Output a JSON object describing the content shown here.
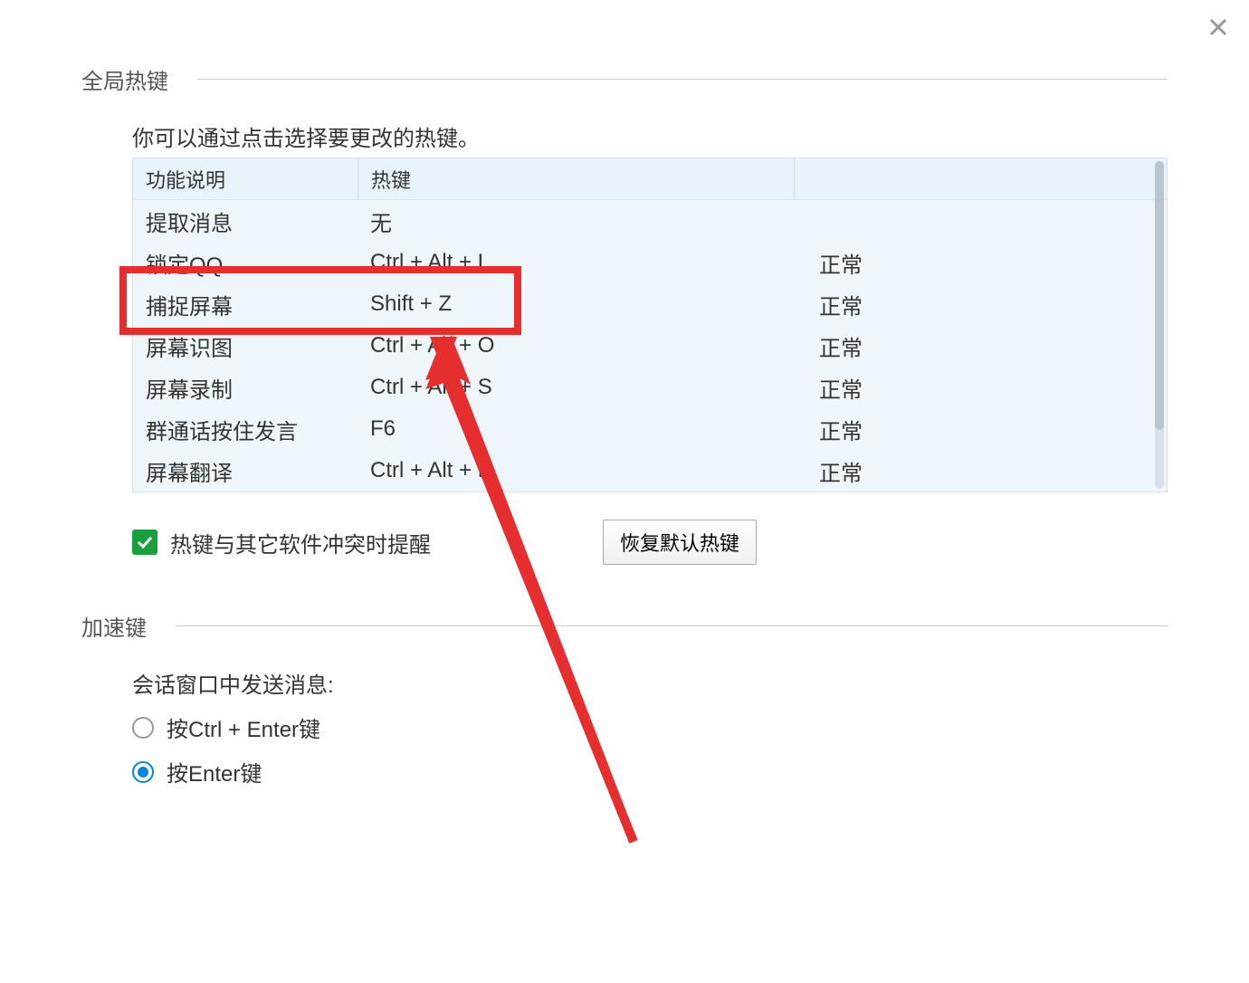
{
  "close_label": "×",
  "section1": {
    "title": "全局热键",
    "intro": "你可以通过点击选择要更改的热键。",
    "headers": {
      "func": "功能说明",
      "hotkey": "热键"
    },
    "rows": [
      {
        "func": "提取消息",
        "hotkey": "无",
        "status": ""
      },
      {
        "func": "锁定QQ",
        "hotkey": "Ctrl + Alt + L",
        "status": "正常"
      },
      {
        "func": "捕捉屏幕",
        "hotkey": "Shift + Z",
        "status": "正常"
      },
      {
        "func": "屏幕识图",
        "hotkey": "Ctrl + Alt + O",
        "status": "正常"
      },
      {
        "func": "屏幕录制",
        "hotkey": "Ctrl + Alt + S",
        "status": "正常"
      },
      {
        "func": "群通话按住发言",
        "hotkey": "F6",
        "status": "正常"
      },
      {
        "func": "屏幕翻译",
        "hotkey": "Ctrl + Alt + F",
        "status": "正常"
      }
    ],
    "conflict_checkbox": "热键与其它软件冲突时提醒",
    "restore_button": "恢复默认热键"
  },
  "section2": {
    "title": "加速键",
    "send_label": "会话窗口中发送消息:",
    "options": [
      {
        "label": "按Ctrl + Enter键",
        "checked": false
      },
      {
        "label": "按Enter键",
        "checked": true
      }
    ]
  }
}
